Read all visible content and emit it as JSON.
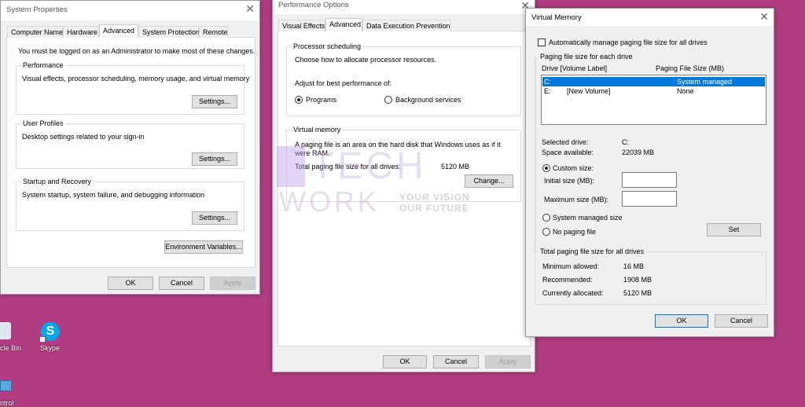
{
  "colors": {
    "desktop": "#b13c82",
    "selection": "#0078d7",
    "dialog_bg": "#f0f0f0"
  },
  "desktop": {
    "icons": [
      {
        "label": "cle Bin",
        "icon": "recycle-bin-icon"
      },
      {
        "label": "Skype",
        "icon": "skype-icon"
      },
      {
        "label": "ntrol",
        "icon": "control-panel-icon"
      }
    ]
  },
  "watermark": {
    "line1": "TECH",
    "line2": "WORK",
    "tag1": "YOUR VISION",
    "tag2": "OUR FUTURE"
  },
  "sysprops": {
    "title": "System Properties",
    "tabs": [
      "Computer Name",
      "Hardware",
      "Advanced",
      "System Protection",
      "Remote"
    ],
    "active_tab": "Advanced",
    "notice": "You must be logged on as an Administrator to make most of these changes.",
    "groups": [
      {
        "title": "Performance",
        "desc": "Visual effects, processor scheduling, memory usage, and virtual memory",
        "button": "Settings..."
      },
      {
        "title": "User Profiles",
        "desc": "Desktop settings related to your sign-in",
        "button": "Settings..."
      },
      {
        "title": "Startup and Recovery",
        "desc": "System startup, system failure, and debugging information",
        "button": "Settings..."
      }
    ],
    "env_button": "Environment Variables...",
    "ok": "OK",
    "cancel": "Cancel",
    "apply": "Apply"
  },
  "perf": {
    "title": "Performance Options",
    "tabs": [
      "Visual Effects",
      "Advanced",
      "Data Execution Prevention"
    ],
    "active_tab": "Advanced",
    "sched_title": "Processor scheduling",
    "sched_desc": "Choose how to allocate processor resources.",
    "adjust_label": "Adjust for best performance of:",
    "radio_programs": "Programs",
    "radio_background": "Background services",
    "selected": "Programs",
    "vm_title": "Virtual memory",
    "vm_desc1": "A paging file is an area on the hard disk that Windows uses as if it",
    "vm_desc2": "were RAM.",
    "total_label": "Total paging file size for all drives:",
    "total_value": "5120 MB",
    "change": "Change...",
    "ok": "OK",
    "cancel": "Cancel",
    "apply": "Apply"
  },
  "vm": {
    "title": "Virtual Memory",
    "auto_manage": "Automatically manage paging file size for all drives",
    "auto_manage_checked": false,
    "group_title": "Paging file size for each drive",
    "col_drive": "Drive  [Volume Label]",
    "col_size": "Paging File Size (MB)",
    "drives": [
      {
        "drive": "C:",
        "label": "",
        "size": "System managed",
        "selected": true
      },
      {
        "drive": "E:",
        "label": "[New Volume]",
        "size": "None",
        "selected": false
      }
    ],
    "selected_drive_label": "Selected drive:",
    "selected_drive": "C:",
    "space_label": "Space available:",
    "space": "22039 MB",
    "custom": "Custom size:",
    "initial": "Initial size (MB):",
    "initial_value": "",
    "maximum": "Maximum size (MB):",
    "maximum_value": "",
    "system_managed": "System managed size",
    "no_paging": "No paging file",
    "selected_option": "Custom size",
    "set": "Set",
    "total_title": "Total paging file size for all drives",
    "min_label": "Minimum allowed:",
    "min": "16 MB",
    "rec_label": "Recommended:",
    "rec": "1908 MB",
    "cur_label": "Currently allocated:",
    "cur": "5120 MB",
    "ok": "OK",
    "cancel": "Cancel"
  }
}
